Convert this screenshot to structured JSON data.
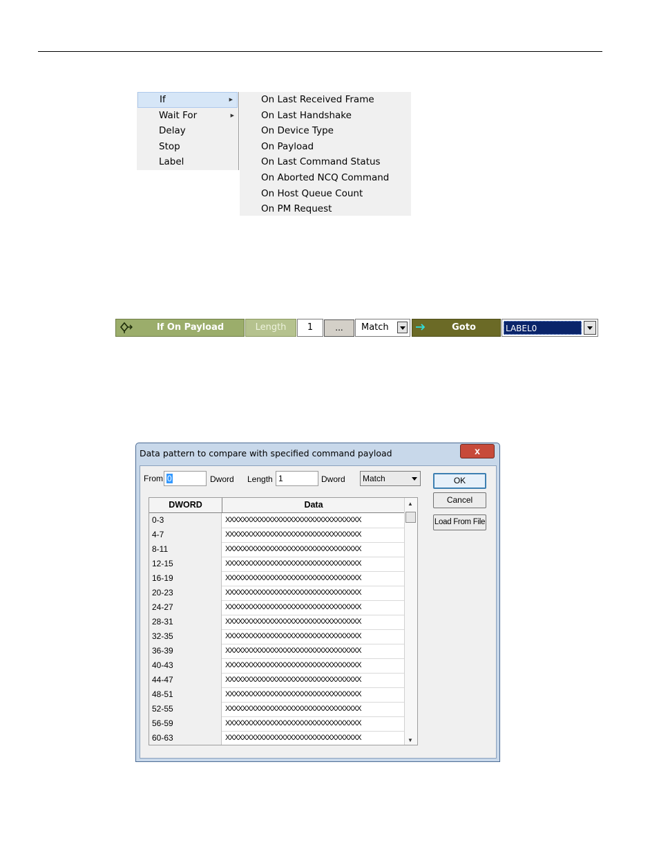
{
  "menu": {
    "items": [
      {
        "label": "If",
        "has_submenu": true
      },
      {
        "label": "Wait For",
        "has_submenu": true
      },
      {
        "label": "Delay",
        "has_submenu": false
      },
      {
        "label": "Stop",
        "has_submenu": false
      },
      {
        "label": "Label",
        "has_submenu": false
      }
    ],
    "submenu": [
      "On Last Received Frame",
      "On Last Handshake",
      "On Device Type",
      "On Payload",
      "On Last Command Status",
      "On Aborted NCQ Command",
      "On Host Queue Count",
      "On PM Request"
    ]
  },
  "rule": {
    "condition_label": "If On Payload",
    "length_label": "Length",
    "length_value": "1",
    "browse_label": "...",
    "match_value": "Match",
    "action_label": "Goto",
    "target_value": "LABEL0",
    "colors": {
      "condition": "#9bad6b",
      "action": "#6b6a26",
      "selection": "#0a246a"
    }
  },
  "dialog": {
    "title": "Data pattern to compare with specified command payload",
    "close_label": "x",
    "from_label": "From",
    "from_value": "0",
    "dword_label": "Dword",
    "length_label": "Length",
    "length_value": "1",
    "dword_label2": "Dword",
    "match_value": "Match",
    "ok_label": "OK",
    "cancel_label": "Cancel",
    "load_label": "Load From File",
    "columns": [
      "DWORD",
      "Data"
    ],
    "rows": [
      {
        "dword": "0-3",
        "data": "XXXXXXXXXXXXXXXXXXXXXXXXXXXXXXXX"
      },
      {
        "dword": "4-7",
        "data": "XXXXXXXXXXXXXXXXXXXXXXXXXXXXXXXX"
      },
      {
        "dword": "8-11",
        "data": "XXXXXXXXXXXXXXXXXXXXXXXXXXXXXXXX"
      },
      {
        "dword": "12-15",
        "data": "XXXXXXXXXXXXXXXXXXXXXXXXXXXXXXXX"
      },
      {
        "dword": "16-19",
        "data": "XXXXXXXXXXXXXXXXXXXXXXXXXXXXXXXX"
      },
      {
        "dword": "20-23",
        "data": "XXXXXXXXXXXXXXXXXXXXXXXXXXXXXXXX"
      },
      {
        "dword": "24-27",
        "data": "XXXXXXXXXXXXXXXXXXXXXXXXXXXXXXXX"
      },
      {
        "dword": "28-31",
        "data": "XXXXXXXXXXXXXXXXXXXXXXXXXXXXXXXX"
      },
      {
        "dword": "32-35",
        "data": "XXXXXXXXXXXXXXXXXXXXXXXXXXXXXXXX"
      },
      {
        "dword": "36-39",
        "data": "XXXXXXXXXXXXXXXXXXXXXXXXXXXXXXXX"
      },
      {
        "dword": "40-43",
        "data": "XXXXXXXXXXXXXXXXXXXXXXXXXXXXXXXX"
      },
      {
        "dword": "44-47",
        "data": "XXXXXXXXXXXXXXXXXXXXXXXXXXXXXXXX"
      },
      {
        "dword": "48-51",
        "data": "XXXXXXXXXXXXXXXXXXXXXXXXXXXXXXXX"
      },
      {
        "dword": "52-55",
        "data": "XXXXXXXXXXXXXXXXXXXXXXXXXXXXXXXX"
      },
      {
        "dword": "56-59",
        "data": "XXXXXXXXXXXXXXXXXXXXXXXXXXXXXXXX"
      },
      {
        "dword": "60-63",
        "data": "XXXXXXXXXXXXXXXXXXXXXXXXXXXXXXXX"
      }
    ]
  }
}
